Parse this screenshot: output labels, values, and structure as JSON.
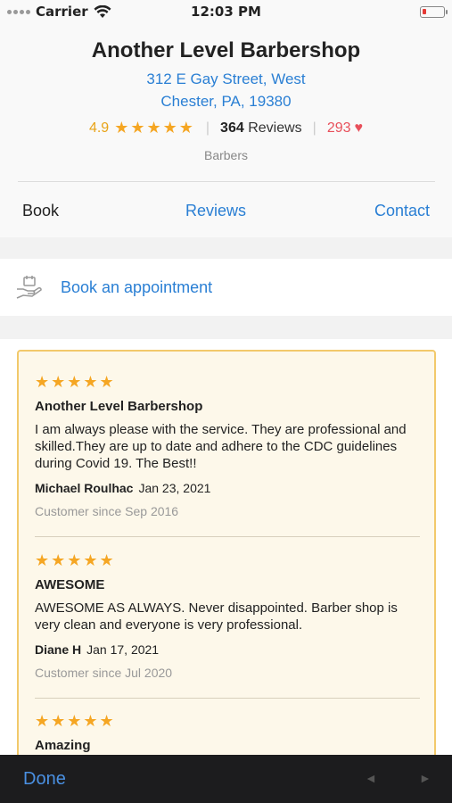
{
  "status": {
    "carrier": "Carrier",
    "time": "12:03 PM"
  },
  "shop": {
    "name": "Another Level Barbershop",
    "address_line1": "312 E Gay Street, West",
    "address_line2": "Chester, PA, 19380",
    "rating": "4.9",
    "review_count": "364",
    "reviews_label": "Reviews",
    "likes": "293",
    "category": "Barbers"
  },
  "tabs": {
    "book": "Book",
    "reviews": "Reviews",
    "contact": "Contact"
  },
  "appointment": {
    "label": "Book an appointment"
  },
  "reviews": [
    {
      "title": "Another Level Barbershop",
      "body": "I am always please with the service. They are professional and skilled.They are up to date and adhere to the CDC guidelines during Covid 19. The Best!!",
      "author": "Michael Roulhac",
      "date": "Jan 23, 2021",
      "since": "Customer since Sep 2016"
    },
    {
      "title": "AWESOME",
      "body": "AWESOME AS ALWAYS.  Never disappointed. Barber shop is very clean and everyone is very professional.",
      "author": "Diane H",
      "date": "Jan 17, 2021",
      "since": "Customer since Jul 2020"
    },
    {
      "title": "Amazing"
    }
  ],
  "toolbar": {
    "done": "Done"
  },
  "colors": {
    "accent": "#2a7fd4",
    "star": "#f5a623",
    "heart": "#e8505b",
    "card_border": "#f2c96b",
    "card_bg": "#fdf8ea"
  }
}
